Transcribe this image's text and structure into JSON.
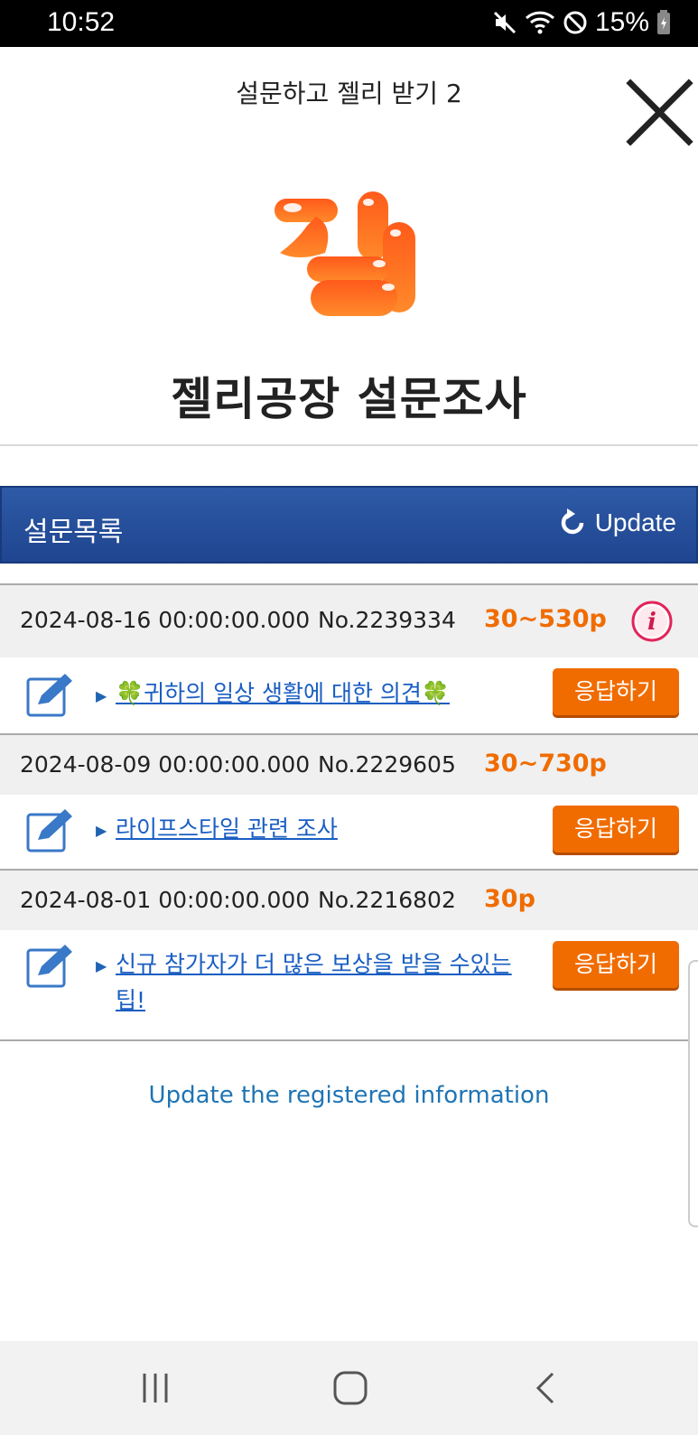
{
  "status_bar": {
    "time": "10:52",
    "battery": "15%"
  },
  "header": {
    "title": "설문하고 젤리 받기 2"
  },
  "logo": {
    "text": "젤"
  },
  "page_title": "젤리공장 설문조사",
  "section": {
    "label": "설문목록",
    "update_label": "Update"
  },
  "surveys": [
    {
      "date": "2024-08-16 00:00:00.000",
      "number": "No.2239334",
      "points": "30~530p",
      "title": "🍀귀하의 일상 생활에 대한 의견🍀",
      "respond_label": "응답하기"
    },
    {
      "date": "2024-08-09 00:00:00.000",
      "number": "No.2229605",
      "points": "30~730p",
      "title": "라이프스타일 관련 조사",
      "respond_label": "응답하기"
    },
    {
      "date": "2024-08-01 00:00:00.000",
      "number": "No.2216802",
      "points": "30p",
      "title": "신규 참가자가 더 많은 보상을 받을 수있는 팁!",
      "respond_label": "응답하기"
    }
  ],
  "footer": {
    "link": "Update the registered information"
  },
  "colors": {
    "accent_orange": "#f06c00",
    "header_blue": "#2e5aa6",
    "link_blue": "#1a5ec2"
  }
}
